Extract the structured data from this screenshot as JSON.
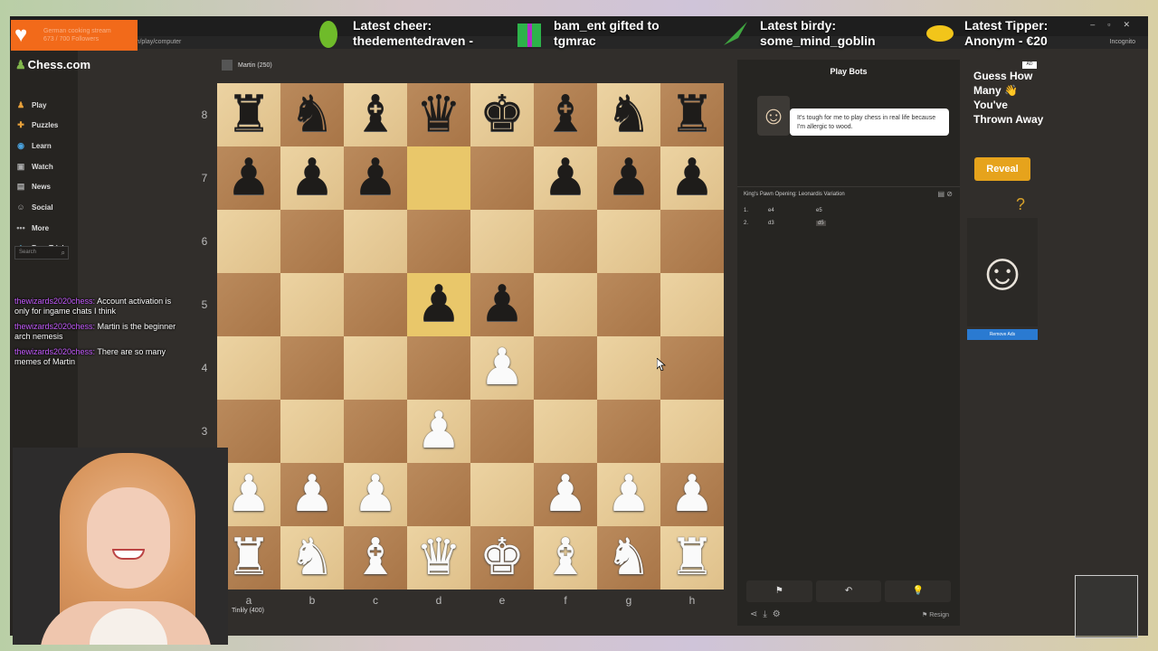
{
  "stream": {
    "follower_goal": "German cooking stream",
    "follower_count": "673 / 700 Followers",
    "alerts": [
      {
        "label": "Latest cheer:",
        "value": "thedementedraven -",
        "icon": "gem-icon",
        "color": "#6fbb2a"
      },
      {
        "label": "bam_ent gifted to",
        "value": "tgmrac",
        "icon": "gift-icon",
        "color": "#2db34a"
      },
      {
        "label": "Latest birdy:",
        "value": "some_mind_goblin",
        "icon": "feather-icon",
        "color": "#3fa640"
      },
      {
        "label": "Latest Tipper:",
        "value": "Anonym - €20",
        "icon": "coin-icon",
        "color": "#f2c51a"
      }
    ]
  },
  "browser": {
    "url": "chess.com/play/computer",
    "mode": "Incognito"
  },
  "sidebar": {
    "logo": "Chess.com",
    "items": [
      {
        "label": "Play",
        "icon": "play-icon"
      },
      {
        "label": "Puzzles",
        "icon": "puzzle-icon"
      },
      {
        "label": "Learn",
        "icon": "learn-icon"
      },
      {
        "label": "Watch",
        "icon": "watch-icon"
      },
      {
        "label": "News",
        "icon": "news-icon"
      },
      {
        "label": "Social",
        "icon": "social-icon"
      },
      {
        "label": "More",
        "icon": "more-icon"
      },
      {
        "label": "Free Trial",
        "icon": "diamond-icon"
      }
    ],
    "search_placeholder": "Search"
  },
  "chat": [
    {
      "user": "thewizards2020chess:",
      "text": "Account activation is only for ingame chats I think"
    },
    {
      "user": "thewizards2020chess:",
      "text": "Martin is the beginner arch nemesis"
    },
    {
      "user": "thewizards2020chess:",
      "text": "There are so many memes of Martin"
    }
  ],
  "game": {
    "top_player": "Martin (250)",
    "bottom_player": "Tinlily (400)",
    "ranks": [
      "8",
      "7",
      "6",
      "5",
      "4",
      "3",
      "2",
      "1"
    ],
    "files": [
      "a",
      "b",
      "c",
      "d",
      "e",
      "f",
      "g",
      "h"
    ],
    "board": [
      [
        "br",
        "bn",
        "bb",
        "bq",
        "bk",
        "bb",
        "bn",
        "br"
      ],
      [
        "bp",
        "bp",
        "bp",
        "",
        "",
        "bp",
        "bp",
        "bp"
      ],
      [
        "",
        "",
        "",
        "",
        "",
        "",
        "",
        ""
      ],
      [
        "",
        "",
        "",
        "bp",
        "bp",
        "",
        "",
        ""
      ],
      [
        "",
        "",
        "",
        "",
        "wp",
        "",
        "",
        ""
      ],
      [
        "",
        "",
        "",
        "wp",
        "",
        "",
        "",
        ""
      ],
      [
        "wp",
        "wp",
        "wp",
        "",
        "",
        "wp",
        "wp",
        "wp"
      ],
      [
        "wr",
        "wn",
        "wb",
        "wq",
        "wk",
        "wb",
        "wn",
        "wr"
      ]
    ],
    "highlighted_squares": [
      "d7",
      "d5"
    ]
  },
  "panel": {
    "title": "Play Bots",
    "bot_message": "It's tough for me to play chess in real life because I'm allergic to wood.",
    "opening": "King's Pawn Opening: Leonardis Variation",
    "moves": [
      {
        "n": "1.",
        "white": "e4",
        "black": "e5"
      },
      {
        "n": "2.",
        "white": "d3",
        "black": "d5"
      }
    ],
    "controls": [
      "⚑",
      "↶",
      "💡"
    ],
    "resign_label": "Resign"
  },
  "ad": {
    "title": "Guess How Many 👋 You've Thrown Away",
    "reveal_label": "Reveal",
    "remove_ads_label": "Remove Ads",
    "badge": "AD"
  }
}
